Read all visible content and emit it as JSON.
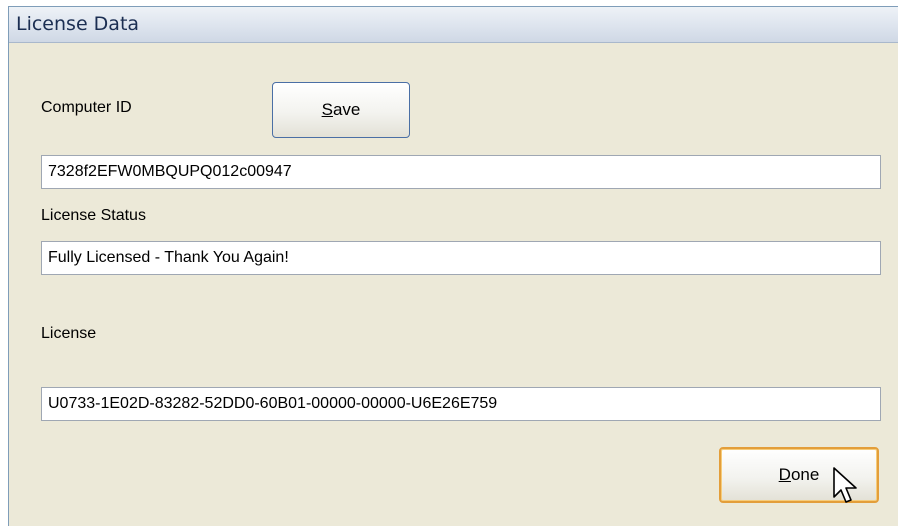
{
  "window": {
    "title": "License Data"
  },
  "computer_id": {
    "label": "Computer ID",
    "value": "7328f2EFW0MBQUPQ012c00947"
  },
  "save_button": {
    "mnemonic": "S",
    "rest": "ave"
  },
  "license_status": {
    "label": "License Status",
    "value": "Fully Licensed - Thank You Again!"
  },
  "license": {
    "label": "License",
    "value": "U0733-1E02D-83282-52DD0-60B01-00000-00000-U6E26E759"
  },
  "done_button": {
    "mnemonic": "D",
    "rest": "one"
  },
  "icons": {
    "cursor": "arrow-cursor-icon"
  }
}
